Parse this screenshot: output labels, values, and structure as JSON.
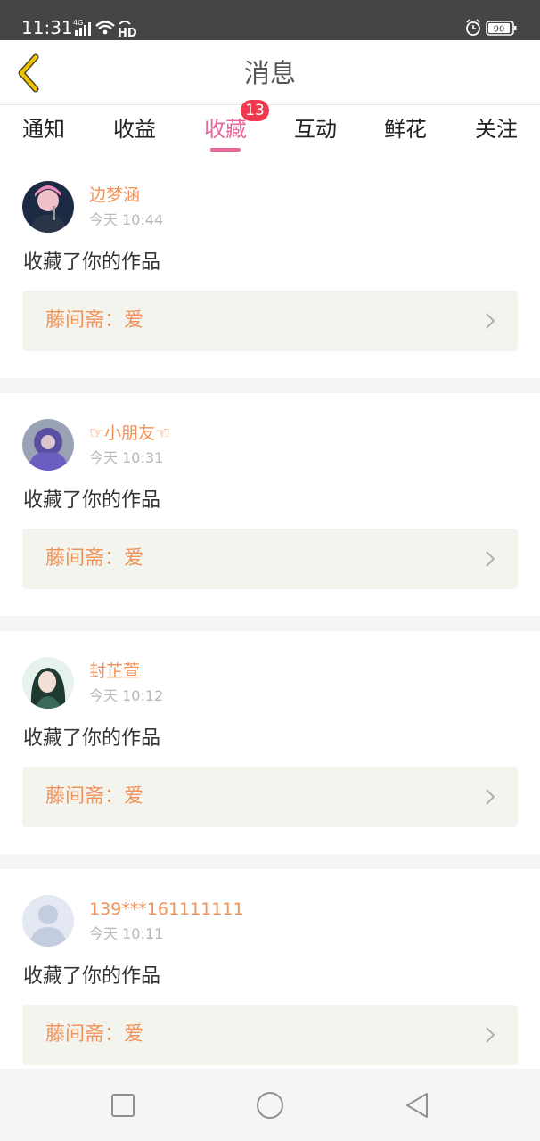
{
  "status_bar": {
    "time": "11:31",
    "network": "4G",
    "hd": "HD",
    "battery": "90"
  },
  "header": {
    "back_icon": "chevron-left-icon",
    "title": "消息"
  },
  "tabs": [
    {
      "label": "通知"
    },
    {
      "label": "收益"
    },
    {
      "label": "收藏",
      "active": true,
      "badge": "13"
    },
    {
      "label": "互动"
    },
    {
      "label": "鲜花"
    },
    {
      "label": "关注"
    }
  ],
  "messages": [
    {
      "user": "边梦涵",
      "time": "今天 10:44",
      "text": "收藏了你的作品",
      "work": "藤间斋：爱"
    },
    {
      "user": "☞小朋友☜",
      "time": "今天 10:31",
      "text": "收藏了你的作品",
      "work": "藤间斋：爱"
    },
    {
      "user": "封芷萱",
      "time": "今天 10:12",
      "text": "收藏了你的作品",
      "work": "藤间斋：爱"
    },
    {
      "user": "139***161111111",
      "time": "今天 10:11",
      "text": "收藏了你的作品",
      "work": "藤间斋：爱"
    }
  ],
  "colors": {
    "accent_pink": "#e8679b",
    "name_orange": "#f0935a",
    "badge_red": "#f0384e",
    "back_arrow_yellow": "#f2c200"
  }
}
